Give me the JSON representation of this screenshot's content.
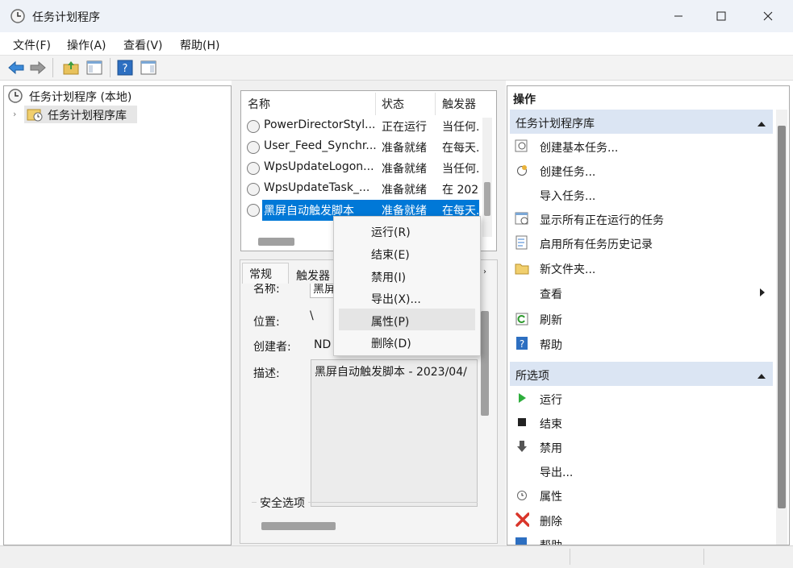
{
  "window": {
    "title": "任务计划程序",
    "minimize_icon": "minimize-icon",
    "maximize_icon": "maximize-icon",
    "close_icon": "close-icon"
  },
  "menu": [
    "文件(F)",
    "操作(A)",
    "查看(V)",
    "帮助(H)"
  ],
  "tree": {
    "root": "任务计划程序 (本地)",
    "child": "任务计划程序库"
  },
  "task_list": {
    "columns": [
      "名称",
      "状态",
      "触发器"
    ],
    "rows": [
      {
        "name": "PowerDirectorStyl...",
        "status": "正在运行",
        "trigger": "当任何..."
      },
      {
        "name": "User_Feed_Synchr...",
        "status": "准备就绪",
        "trigger": "在每天..."
      },
      {
        "name": "WpsUpdateLogon...",
        "status": "准备就绪",
        "trigger": "当任何..."
      },
      {
        "name": "WpsUpdateTask_...",
        "status": "准备就绪",
        "trigger": "在 202..."
      },
      {
        "name": "黑屏自动触发脚本",
        "status": "准备就绪",
        "trigger": "在每天..."
      }
    ]
  },
  "detail": {
    "tabs": [
      "常规",
      "触发器"
    ],
    "name_label": "名称:",
    "name_value": "黑屏",
    "location_label": "位置:",
    "location_value": "\\",
    "author_label": "创建者:",
    "author_value": "ND",
    "desc_label": "描述:",
    "desc_value": "黑屏自动触发脚本 - 2023/04/",
    "security_label": "安全选项"
  },
  "context_menu": [
    "运行(R)",
    "结束(E)",
    "禁用(I)",
    "导出(X)...",
    "属性(P)",
    "删除(D)"
  ],
  "actions": {
    "header": "操作",
    "section1": {
      "title": "任务计划程序库",
      "items": [
        "创建基本任务...",
        "创建任务...",
        "导入任务...",
        "显示所有正在运行的任务",
        "启用所有任务历史记录",
        "新文件夹...",
        "查看",
        "刷新",
        "帮助"
      ]
    },
    "section2": {
      "title": "所选项",
      "items": [
        "运行",
        "结束",
        "禁用",
        "导出...",
        "属性",
        "删除",
        "帮助"
      ]
    }
  },
  "colors": {
    "selection": "#0078d7",
    "section_header": "#dbe5f3",
    "titlebar": "#eef2f8"
  }
}
